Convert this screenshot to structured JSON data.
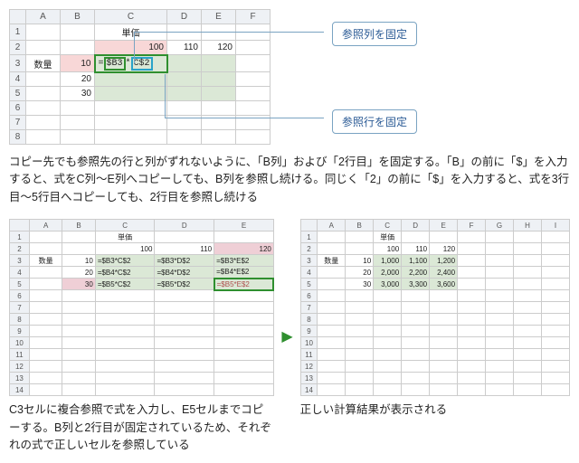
{
  "top": {
    "cols": [
      "A",
      "B",
      "C",
      "D",
      "E",
      "F"
    ],
    "rows": [
      "1",
      "2",
      "3",
      "4",
      "5",
      "6",
      "7",
      "8"
    ],
    "labelUnitPrice": "単価",
    "prices": [
      "100",
      "110",
      "120"
    ],
    "labelQty": "数量",
    "qty": [
      "10",
      "20",
      "30"
    ],
    "formulaEq": "=",
    "formulaPart1": "$B3",
    "formulaStar": "*",
    "formulaPart2": "C$2"
  },
  "callout1": "参照列を固定",
  "callout2": "参照行を固定",
  "para1": "コピー先でも参照先の行と列がずれないように、「B列」および「2行目」を固定する。「B」の前に「$」を入力すると、式をC列～E列へコピーしても、B列を参照し続ける。同じく「2」の前に「$」を入力すると、式を3行目～5行目へコピーしても、2行目を参照し続ける",
  "left": {
    "cols": [
      "A",
      "B",
      "C",
      "D",
      "E"
    ],
    "rows": [
      "1",
      "2",
      "3",
      "4",
      "5",
      "6",
      "7",
      "8",
      "9",
      "10",
      "11",
      "12",
      "13",
      "14"
    ],
    "labelUnitPrice": "単価",
    "prices": [
      "100",
      "110",
      "120"
    ],
    "labelQty": "数量",
    "table": [
      [
        "10",
        "=$B3*C$2",
        "=$B3*D$2",
        "=$B3*E$2"
      ],
      [
        "20",
        "=$B4*C$2",
        "=$B4*D$2",
        "=$B4*E$2"
      ],
      [
        "30",
        "=$B5*C$2",
        "=$B5*D$2",
        "=$B5*E$2"
      ]
    ]
  },
  "right": {
    "cols": [
      "A",
      "B",
      "C",
      "D",
      "E",
      "F",
      "G",
      "H",
      "I"
    ],
    "rows": [
      "1",
      "2",
      "3",
      "4",
      "5",
      "6",
      "7",
      "8",
      "9",
      "10",
      "11",
      "12",
      "13",
      "14"
    ],
    "labelUnitPrice": "単価",
    "prices": [
      "100",
      "110",
      "120"
    ],
    "labelQty": "数量",
    "table": [
      [
        "10",
        "1,000",
        "1,100",
        "1,200"
      ],
      [
        "20",
        "2,000",
        "2,200",
        "2,400"
      ],
      [
        "30",
        "3,000",
        "3,300",
        "3,600"
      ]
    ]
  },
  "captionLeft": "C3セルに複合参照で式を入力し、E5セルまでコピーする。B列と2行目が固定されているため、それぞれの式で正しいセルを参照している",
  "captionRight": "正しい計算結果が表示される",
  "chart_data": {
    "type": "table",
    "title": "数量×単価",
    "categories_col_label": "数量",
    "categories_row_label": "単価",
    "row_headers": [
      100,
      110,
      120
    ],
    "col_headers": [
      10,
      20,
      30
    ],
    "values": [
      [
        1000,
        1100,
        1200
      ],
      [
        2000,
        2200,
        2400
      ],
      [
        3000,
        3300,
        3600
      ]
    ]
  }
}
